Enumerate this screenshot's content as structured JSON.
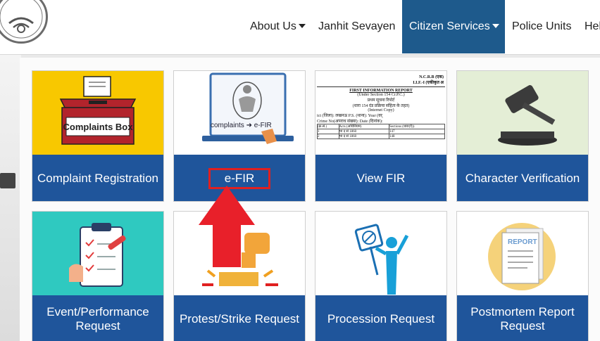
{
  "nav": {
    "items": [
      {
        "label": "About Us",
        "dropdown": true
      },
      {
        "label": "Janhit Sevayen",
        "dropdown": false
      },
      {
        "label": "Citizen Services",
        "dropdown": true,
        "active": true
      },
      {
        "label": "Police Units",
        "dropdown": false
      },
      {
        "label": "Hel",
        "dropdown": false
      }
    ],
    "active_color": "#1e5a8c"
  },
  "cards": [
    {
      "label": "Complaint Registration",
      "icon": "ballot-box-icon",
      "image_text": "Complaints Box"
    },
    {
      "label": "e-FIR",
      "icon": "laptop-emblem-icon",
      "image_text": "complaints ➜ e-FIR",
      "highlighted": true
    },
    {
      "label": "View FIR",
      "icon": "fir-document-icon"
    },
    {
      "label": "Character Verification",
      "icon": "gavel-icon"
    },
    {
      "label": "Event/Performance Request",
      "icon": "clipboard-icon"
    },
    {
      "label": "Protest/Strike Request",
      "icon": "protest-icon"
    },
    {
      "label": "Procession Request",
      "icon": "procession-icon"
    },
    {
      "label": "Postmortem Report Request",
      "icon": "report-icon",
      "image_text": "REPORT"
    }
  ],
  "fir_doc": {
    "ncrb": "N.C.R.B (एक)",
    "form": "I.I.F.-I (एकीकृत अ",
    "title": "FIRST INFORMATION REPORT",
    "section": "(Under Section 154 Cr.P.C.)",
    "title_hi": "प्रथम सूचना रिपोर्ट",
    "section_hi": "(धारा 154 दंड प्रक्रिया संहिता के तहत)",
    "copy": "(Internet Copy)",
    "row1": "ict (जिला): लखनऊ        P.S. (थाना):                Year (वर्",
    "row2": "Crime No(अपराध संख्या):                    Date (दिनांक):",
    "th1": "(क्र.सं.)",
    "th2": "Acts (अधिनियम)",
    "th3": "Sections (धारा(एँ))",
    "r1c1": "1",
    "r1c2": "भा द सं 1860",
    "r1c3": "147",
    "r2c1": "2",
    "r2c2": "भा द सं 1860",
    "r2c3": "148"
  },
  "colors": {
    "card_label_bg": "#1f559b",
    "arrow": "#e8202a",
    "highlight_border": "#e02020"
  }
}
